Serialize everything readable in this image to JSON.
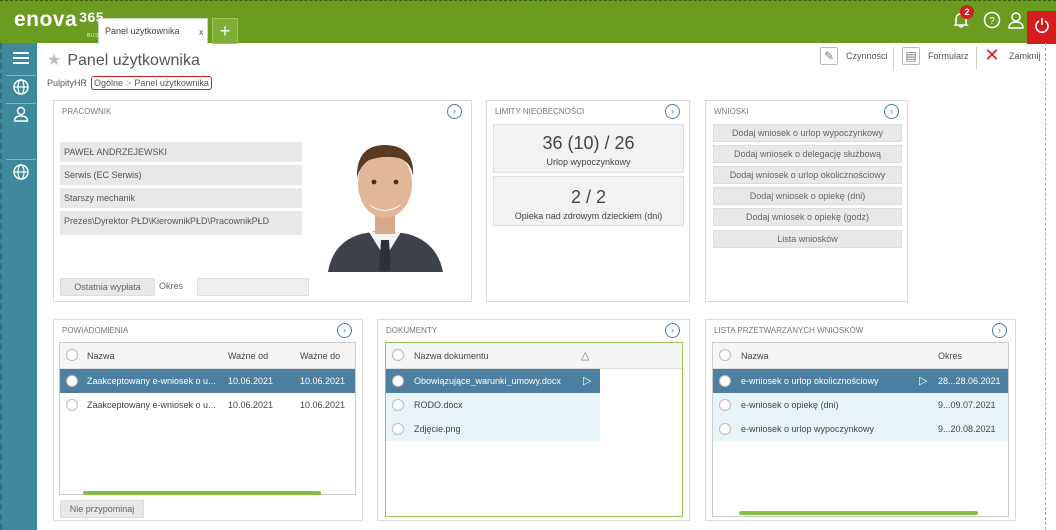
{
  "app": {
    "brand": "enova",
    "brand_version": "365",
    "brand_sub": "BUSINESS",
    "tab_label": "Panel użytkownika",
    "tab_close": "x",
    "tab_add": "+",
    "notification_count": "2"
  },
  "page": {
    "title": "Panel użytkownika",
    "breadcrumb": [
      "PulpityHR",
      "Ogólne",
      "Panel użytkownika"
    ],
    "actions": {
      "czynnosci": "Czynności",
      "formularz": "Formularz",
      "zamknij": "Zamknij"
    }
  },
  "pracownik": {
    "title": "PRACOWNIK",
    "fields": [
      "PAWEŁ ANDRZEJEWSKI",
      "Serwis (EC Serwis)",
      "Starszy mechanik",
      "Prezes\\Dyrektor PŁD\\KierownikPŁD\\PracownikPŁD"
    ],
    "tab_last_pay": "Ostatnia wypłata",
    "tab_period": "Okres"
  },
  "limity": {
    "title": "LIMITY NIEOBECNOŚCI",
    "items": [
      {
        "value": "36 (10) / 26",
        "label": "Urlop wypoczynkowy"
      },
      {
        "value": "2 / 2",
        "label": "Opieka nad zdrowym dzieckiem (dni)"
      }
    ]
  },
  "wnioski": {
    "title": "WNIOSKI",
    "buttons": [
      "Dodaj wniosek o urlop wypoczynkowy",
      "Dodaj wniosek o delegację służbową",
      "Dodaj wniosek o urlop okolicznościowy",
      "Dodaj wniosek o opiekę (dni)",
      "Dodaj wniosek o opiekę (godz)",
      "Lista wniosków"
    ]
  },
  "powiadomienia": {
    "title": "POWIADOMIENIA",
    "columns": [
      "Nazwa",
      "Ważne od",
      "Ważne do"
    ],
    "rows": [
      [
        "Zaakceptowany e-wniosek o u...",
        "10.06.2021",
        "10.06.2021"
      ],
      [
        "Zaakceptowany e-wniosek o u...",
        "10.06.2021",
        "10.06.2021"
      ]
    ],
    "button": "Nie przypominaj"
  },
  "dokumenty": {
    "title": "DOKUMENTY",
    "column": "Nazwa dokumentu",
    "rows": [
      "Obowiązujące_warunki_umowy.docx",
      "RODO.docx",
      "Zdjęcie.png"
    ]
  },
  "lista": {
    "title": "LISTA PRZETWARZANYCH WNIOSKÓW",
    "columns": [
      "Nazwa",
      "Okres"
    ],
    "rows": [
      [
        "e-wniosek o urlop okolicznościowy",
        "28...28.06.2021"
      ],
      [
        "e-wniosek o opiekę (dni)",
        "9...09.07.2021"
      ],
      [
        "e-wniosek o urlop wypoczynkowy",
        "9...20.08.2021"
      ]
    ]
  }
}
